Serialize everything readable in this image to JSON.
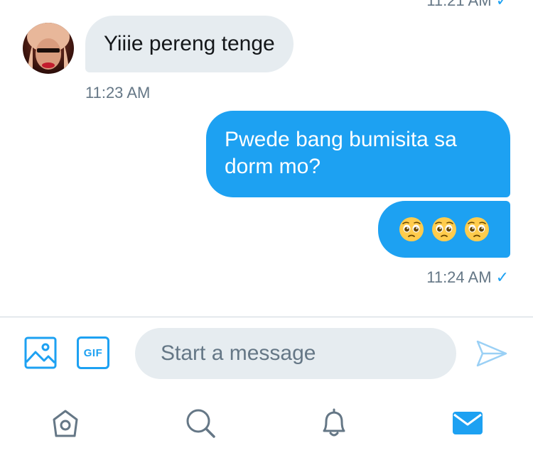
{
  "app": {
    "accent_color": "#1da1f2",
    "incoming_bubble_color": "#e6ecf0",
    "timestamp_color": "#657786"
  },
  "conversation": {
    "clipped_previous_timestamp": "11:21 AM",
    "messages": [
      {
        "direction": "incoming",
        "text": "Yiiie pereng tenge",
        "has_avatar": true
      },
      {
        "direction": "outgoing",
        "text": "Pwede bang bumisita sa dorm mo?"
      },
      {
        "direction": "outgoing",
        "text": "🥺🥺🥺",
        "emoji_count": 3,
        "emoji_name": "pleading-face"
      }
    ],
    "incoming_timestamp": "11:23 AM",
    "outgoing_timestamp": "11:24 AM",
    "outgoing_read_receipt": "✓"
  },
  "composer": {
    "photo_icon": "image-icon",
    "gif_label": "GIF",
    "placeholder": "Start a message",
    "value": "",
    "send_icon": "send-icon"
  },
  "bottom_nav": {
    "items": [
      {
        "icon": "home-icon",
        "active": false
      },
      {
        "icon": "search-icon",
        "active": false
      },
      {
        "icon": "notifications-icon",
        "active": false
      },
      {
        "icon": "messages-icon",
        "active": true
      }
    ]
  }
}
